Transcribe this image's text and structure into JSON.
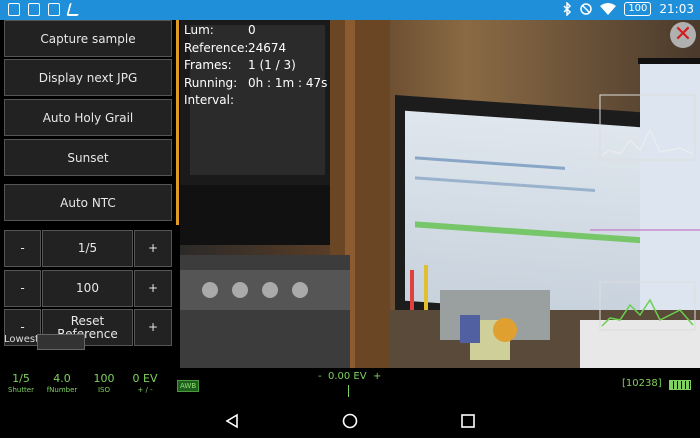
{
  "status_bar": {
    "time": "21:03",
    "battery": "100",
    "left_icons": [
      "image-icon",
      "gallery-icon",
      "sd-card-icon",
      "timelapse-app-icon"
    ],
    "right_icons": [
      "bluetooth-icon",
      "do-not-disturb-icon",
      "wifi-icon"
    ]
  },
  "controls": {
    "capture_sample": "Capture sample",
    "display_next_jpg": "Display next JPG",
    "auto_holy_grail": "Auto Holy Grail",
    "sunset": "Sunset",
    "auto_ntc": "Auto NTC",
    "shutter_row": {
      "minus": "-",
      "value": "1/5",
      "plus": "+"
    },
    "iso_row": {
      "minus": "-",
      "value": "100",
      "plus": "+"
    },
    "reset_row": {
      "minus": "-",
      "value": "Reset Reference",
      "plus": "+"
    },
    "truncated_label": "Lowest"
  },
  "overlay_info": [
    {
      "key": "Lum:",
      "value": "0"
    },
    {
      "key": "Reference:",
      "value": "24674"
    },
    {
      "key": "Frames:",
      "value": "1 (1 / 3)"
    },
    {
      "key": "Running:",
      "value": "0h : 1m : 47s"
    },
    {
      "key": "Interval:",
      "value": ""
    }
  ],
  "bottom_bar": {
    "shutter": {
      "value": "1/5",
      "label": "Shutter"
    },
    "fnumber": {
      "value": "4.0",
      "label": "fNumber"
    },
    "iso": {
      "value": "100",
      "label": "ISO"
    },
    "ev": {
      "value": "0 EV",
      "label": "+ / -"
    },
    "awb": "AWB",
    "ev_minus": "-",
    "ev_readout": "0.00 EV",
    "ev_plus": "+",
    "counter": "[10238]"
  },
  "colors": {
    "status_bar": "#1e8fd8",
    "accent_orange": "#e09a23",
    "readout_green": "#7fd160",
    "close_red": "#d31d1d"
  }
}
